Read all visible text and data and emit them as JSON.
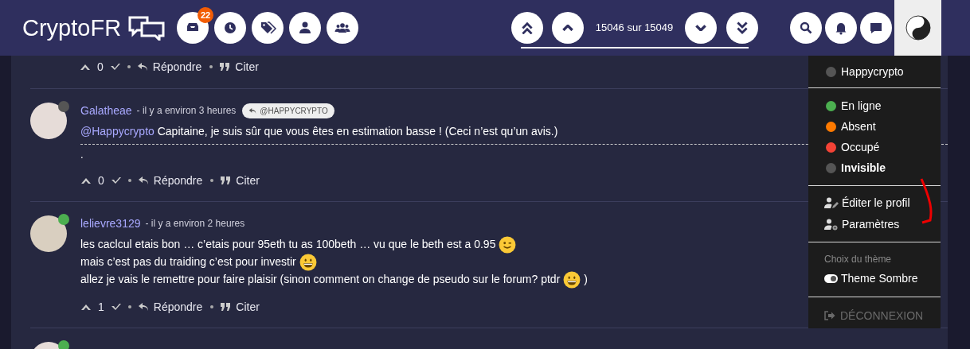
{
  "header": {
    "logo": "CryptoFR",
    "nav_icons": [
      {
        "kind": "inbox",
        "badge": "22"
      },
      {
        "kind": "clock"
      },
      {
        "kind": "tags"
      },
      {
        "kind": "user"
      },
      {
        "kind": "users"
      }
    ],
    "pagination": {
      "label": "15046 sur 15049"
    },
    "right_icons": [
      {
        "kind": "search"
      },
      {
        "kind": "bell"
      },
      {
        "kind": "chat"
      }
    ],
    "profile_open": true
  },
  "posts": [
    {
      "kind": "actions_only",
      "votes": "0",
      "reply": "Répondre",
      "quote": "Citer"
    },
    {
      "kind": "post",
      "author": "Galatheae",
      "online": false,
      "time": "- il y a environ 3 heures",
      "reply_to": "@HAPPYCRYPTO",
      "lines": [
        {
          "kind": "mention",
          "mention": "@Happycrypto",
          "text": "Capitaine, je suis sûr que vous êtes en estimation basse ! (Ceci n’est qu’un avis.)"
        }
      ],
      "signature": ".",
      "votes": "0",
      "reply": "Répondre",
      "quote": "Citer"
    },
    {
      "kind": "post",
      "author": "lelievre3129",
      "online": true,
      "time": "- il y a environ 2 heures",
      "lines": [
        {
          "text": "les caclcul etais bon … c’etais pour 95eth tu as 100beth … vu que le beth est a 0.95",
          "kind": "wink"
        },
        {
          "text": "mais c’est pas du traiding c’est pour investir",
          "kind": "grin"
        },
        {
          "text": "allez je vais le remettre pour faire plaisir (sinon comment on change de pseudo sur le forum? ptdr",
          "kind": "grin",
          "after": ")"
        }
      ],
      "votes": "1",
      "reply": "Répondre",
      "quote": "Citer"
    },
    {
      "kind": "avatar_only",
      "online": true
    }
  ],
  "menu": {
    "user": "Happycrypto",
    "statuses": [
      {
        "label": "En ligne",
        "color": "#4caf50",
        "selected": false
      },
      {
        "label": "Absent",
        "color": "#ff7a00",
        "selected": false
      },
      {
        "label": "Occupé",
        "color": "#f44336",
        "selected": false
      },
      {
        "label": "Invisible",
        "color": "#555555",
        "selected": true
      }
    ],
    "links": [
      {
        "kind": "edit",
        "label": "Éditer le profil"
      },
      {
        "kind": "settings",
        "label": "Paramètres"
      }
    ],
    "theme_heading": "Choix du thème",
    "theme": {
      "label": "Theme Sombre",
      "on": true
    },
    "logout": {
      "label": "DÉCONNEXION",
      "disabled": true
    }
  }
}
